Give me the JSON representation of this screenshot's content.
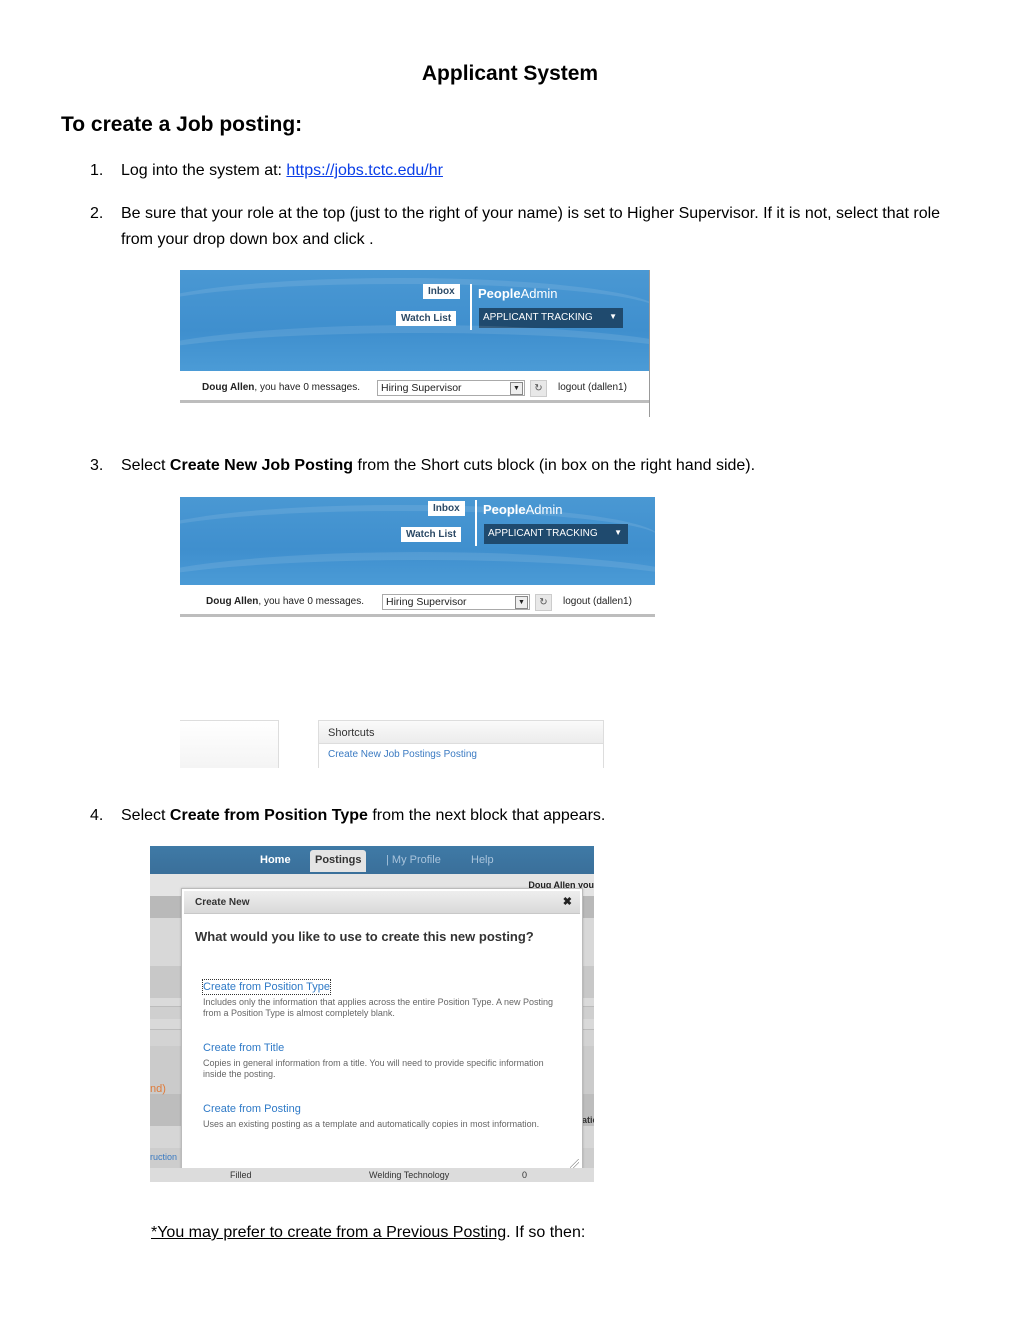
{
  "document": {
    "title": "Applicant System",
    "heading": "To create a Job posting:",
    "steps": [
      {
        "num": "1.",
        "text": "Log into the system at: ",
        "link": "https://jobs.tctc.edu/hr"
      },
      {
        "num": "2.",
        "text": "Be sure that your role at the top (just to the right of your name) is set to Higher Supervisor. If it is not, select that role from your drop down box and click  ."
      },
      {
        "num": "3.",
        "pre": "Select ",
        "bold": "Create New Job Posting",
        "post": "  from the Short cuts block (in box on the right hand side)."
      },
      {
        "num": "4.",
        "pre": "Select ",
        "bold": "Create from Position Type",
        "post": " from the next block that appears."
      }
    ],
    "note": {
      "underlined": "*You may prefer to create from a Previous Posting",
      "rest": ". If so then:"
    }
  },
  "header_screenshot": {
    "inbox_label": "Inbox",
    "watchlist_label": "Watch List",
    "brand_bold": "People",
    "brand_rest": "Admin",
    "module_select": "APPLICANT TRACKING",
    "user_name": "Doug Allen",
    "messages_text": ", you have 0 messages.",
    "role_select": "Hiring Supervisor",
    "logout_text": "logout (dallen1)",
    "brand_color": "#4495d2",
    "module_color": "#1f4a6e"
  },
  "shortcuts_screenshot": {
    "title": "Shortcuts",
    "link": "Create New Job Postings Posting"
  },
  "create_new_screenshot": {
    "nav_tabs": [
      {
        "label": "Home",
        "active": false
      },
      {
        "label": "Postings",
        "active": true
      },
      {
        "label": "| My Profile",
        "active": false
      },
      {
        "label": "Help",
        "active": false
      }
    ],
    "user_fragment": "Doug Allen  you",
    "modal_title": "Create New",
    "question": "What would you like to use to create this new posting?",
    "options": [
      {
        "label": "Create from Position Type",
        "description": "Includes only the information that applies across the entire Position Type. A new Posting from a Position Type is almost completely blank."
      },
      {
        "label": "Create from Title",
        "description": "Copies in general information from a title. You will need to provide specific information inside the posting."
      },
      {
        "label": "Create from Posting",
        "description": "Uses an existing posting as a template and automatically copies in most information."
      }
    ],
    "background_fragments": {
      "left_orange": "nd)",
      "left_link": "ruction",
      "right_text": "atic"
    },
    "bottom_row": {
      "status": "Filled",
      "department": "Welding Technology",
      "count": "0"
    }
  }
}
